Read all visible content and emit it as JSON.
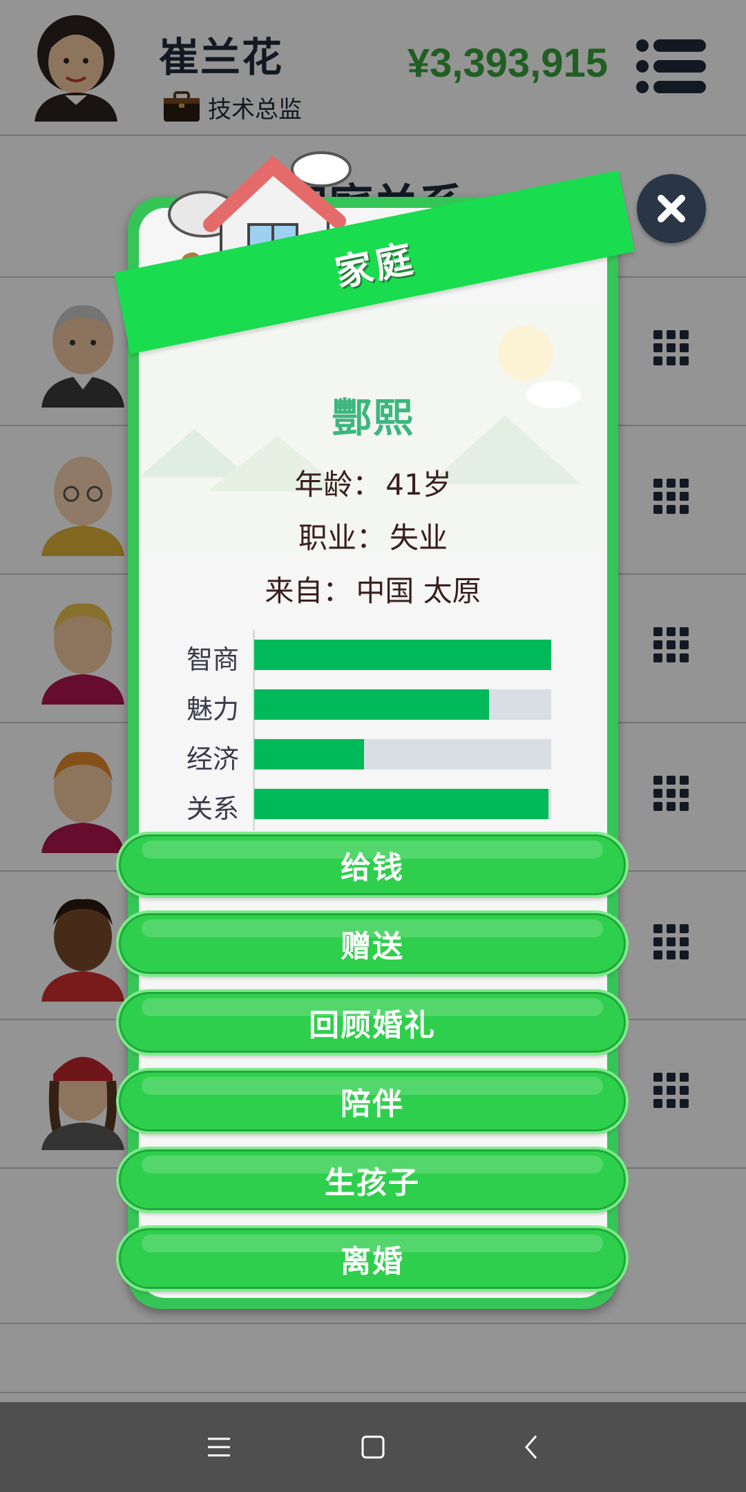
{
  "header": {
    "player_name": "崔兰花",
    "job_title": "技术总监",
    "money": "¥3,393,915"
  },
  "page": {
    "title": "家庭关系"
  },
  "dialog": {
    "banner_label": "家庭",
    "person_name": "酆熙",
    "age_label": "年龄：",
    "age_value": "41岁",
    "job_label": "职业：",
    "job_value": "失业",
    "origin_label": "来自：",
    "origin_value": "中国 太原",
    "stats": [
      {
        "label": "智商",
        "value": 1.0
      },
      {
        "label": "魅力",
        "value": 0.79
      },
      {
        "label": "经济",
        "value": 0.37
      },
      {
        "label": "关系",
        "value": 0.99
      }
    ],
    "actions": [
      {
        "label": "给钱"
      },
      {
        "label": "赠送"
      },
      {
        "label": "回顾婚礼"
      },
      {
        "label": "陪伴"
      },
      {
        "label": "生孩子"
      },
      {
        "label": "离婚"
      }
    ]
  },
  "colors": {
    "accent_green": "#2ecf4c",
    "bar_fill": "#00b959",
    "money_green": "#3aa23c",
    "name_green": "#3cb77d"
  },
  "icons": {
    "menu": "menu-icon",
    "close": "close-icon",
    "grid": "grid-icon",
    "briefcase": "briefcase-icon"
  }
}
